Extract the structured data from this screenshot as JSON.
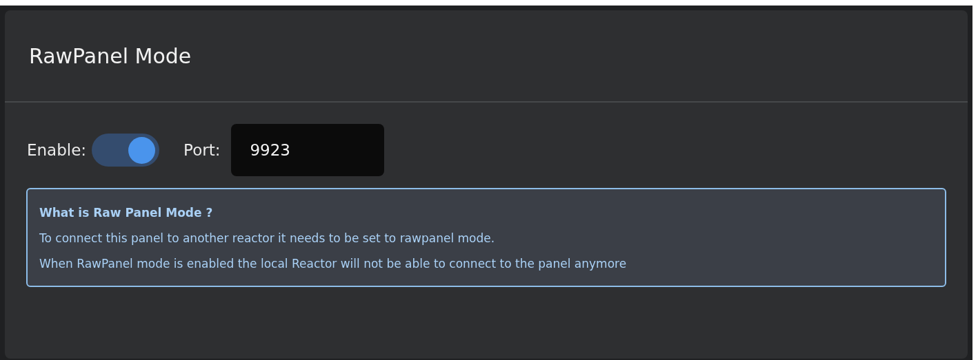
{
  "card": {
    "title": "RawPanel Mode"
  },
  "settings": {
    "enable_label": "Enable:",
    "enable_on": true,
    "port_label": "Port:",
    "port_value": "9923"
  },
  "info": {
    "heading": "What is Raw Panel Mode ?",
    "lines": [
      "To connect this panel to another reactor it needs to be set to rawpanel mode.",
      "When RawPanel mode is enabled the local Reactor will not be able to connect to the panel anymore"
    ]
  }
}
